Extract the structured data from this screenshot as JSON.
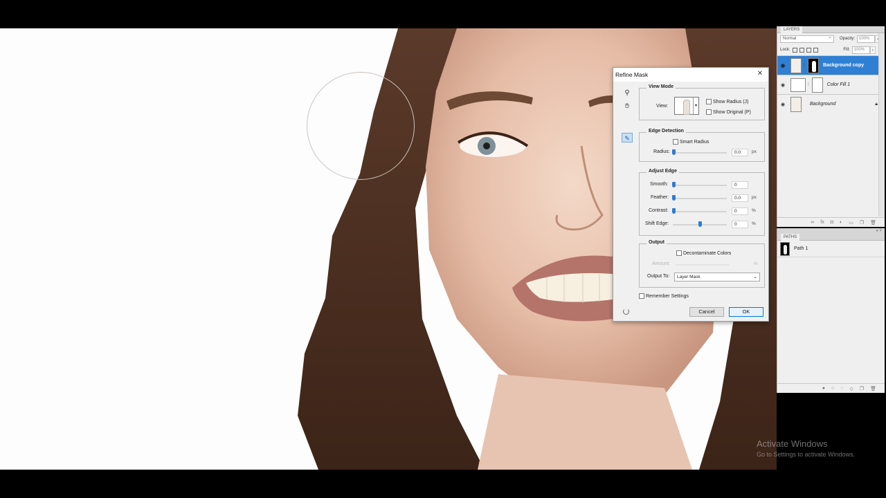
{
  "layers_panel": {
    "tab": "LAYERS",
    "blend_mode": "Normal",
    "opacity_label": "Opacity:",
    "opacity_value": "100%",
    "lock_label": "Lock:",
    "fill_label": "Fill:",
    "fill_value": "100%",
    "layers": [
      {
        "name": "Background copy",
        "selected": true
      },
      {
        "name": "Color Fill 1",
        "selected": false
      },
      {
        "name": "Background",
        "selected": false,
        "locked": true
      }
    ]
  },
  "paths_panel": {
    "tab": "PATHS",
    "paths": [
      {
        "name": "Path 1"
      }
    ]
  },
  "dialog": {
    "title": "Refine Mask",
    "view_mode": {
      "title": "View Mode",
      "view_label": "View:",
      "show_radius": "Show Radius (J)",
      "show_original": "Show Original (P)"
    },
    "edge_detection": {
      "title": "Edge Detection",
      "smart_radius": "Smart Radius",
      "radius_label": "Radius:",
      "radius_value": "0.0",
      "radius_unit": "px"
    },
    "adjust_edge": {
      "title": "Adjust Edge",
      "smooth_label": "Smooth:",
      "smooth_value": "0",
      "feather_label": "Feather:",
      "feather_value": "0.0",
      "feather_unit": "px",
      "contrast_label": "Contrast:",
      "contrast_value": "0",
      "contrast_unit": "%",
      "shift_label": "Shift Edge:",
      "shift_value": "0",
      "shift_unit": "%"
    },
    "output": {
      "title": "Output",
      "decontaminate": "Decontaminate Colors",
      "amount_label": "Amount:",
      "amount_unit": "%",
      "output_to_label": "Output To:",
      "output_to_value": "Layer Mask"
    },
    "remember": "Remember Settings",
    "cancel": "Cancel",
    "ok": "OK"
  },
  "watermark": {
    "line1": "Activate Windows",
    "line2": "Go to Settings to activate Windows."
  }
}
